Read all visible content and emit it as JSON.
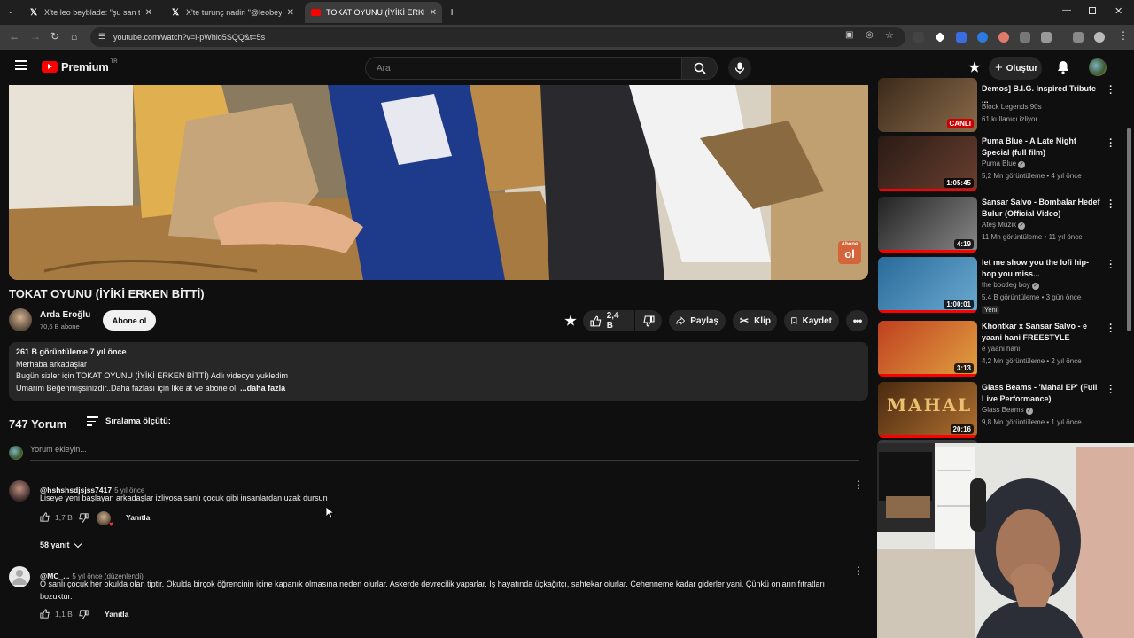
{
  "browser": {
    "tabs": [
      {
        "title": "X'te leo beyblade: \"şu san tişört",
        "favicon": "x-logo",
        "active": false
      },
      {
        "title": "X'te turunç nadiri \"@leobeyblade",
        "favicon": "x-logo",
        "active": false
      },
      {
        "title": "TOKAT OYUNU (İYİKİ ERKEN BİTTİ)",
        "favicon": "youtube-logo",
        "active": true
      }
    ],
    "url": "youtube.com/watch?v=i-pWhlo5SQQ&t=5s"
  },
  "header": {
    "brand": "Premium",
    "region": "TR",
    "search_placeholder": "Ara",
    "create_label": "Oluştur"
  },
  "video": {
    "title": "TOKAT OYUNU (İYİKİ ERKEN BİTTİ)",
    "watermark_line1": "Abone",
    "watermark_line2": "ol",
    "channel_name": "Arda Eroğlu",
    "subscribers": "70,6 B abone",
    "subscribe_label": "Abone ol",
    "like_count": "2,4 B",
    "share_label": "Paylaş",
    "clip_label": "Klip",
    "save_label": "Kaydet"
  },
  "description": {
    "stats": "261 B görüntüleme  7 yıl önce",
    "line1": "Merhaba arkadaşlar",
    "line2": "Bugün sizler için TOKAT OYUNU (İYİKİ ERKEN BİTTİ)  Adlı videoyu yukledim",
    "line3": "Umarım Beğenmişsinizdir..Daha fazlası için like at ve abone ol",
    "more": "...daha fazla"
  },
  "comments_section": {
    "count_label": "747 Yorum",
    "sort_label": "Sıralama ölçütü:",
    "add_placeholder": "Yorum ekleyin...",
    "comments": [
      {
        "author": "@hshshsdjsjss7417",
        "time": "5 yıl önce",
        "text": "Liseye yeni başlayan arkadaşlar izliyosa sanlı çocuk gibi insanlardan uzak dursun",
        "likes": "1,7 B",
        "reply_label": "Yanıtla",
        "replies_label": "58 yanıt"
      },
      {
        "author": "@MC_...",
        "time": "5 yıl önce (düzenlendi)",
        "text": "O sanlı çocuk her okulda olan tiptir. Okulda birçok öğrencinin içine kapanık olmasına neden olurlar. Askerde devrecilik yaparlar. İş hayatında üçkağıtçı, sahtekar olurlar. Cehenneme kadar giderler yani. Çünkü onların fıtratları",
        "text2": "bozuktur.",
        "likes": "1,1 B",
        "reply_label": "Yanıtla"
      }
    ]
  },
  "sidebar": {
    "items": [
      {
        "title": "Demos] B.I.G. Inspired Tribute ...",
        "channel": "Block Legends 90s",
        "meta": "61 kullanıcı izliyor",
        "badge": "CANLI",
        "duration": "",
        "colors": [
          "#3a2a1a",
          "#8a6a4a"
        ]
      },
      {
        "title": "Puma Blue - A Late Night Special (full film)",
        "channel": "Puma Blue",
        "verified": true,
        "meta": "5,2 Mn görüntüleme • 4 yıl önce",
        "duration": "1:05:45",
        "colors": [
          "#2a1a14",
          "#6a4030"
        ]
      },
      {
        "title": "Sansar Salvo - Bombalar Hedef Bulur (Official Video)",
        "channel": "Ateş Müzik",
        "verified": true,
        "meta": "11 Mn görüntüleme • 11 yıl önce",
        "duration": "4:19",
        "colors": [
          "#222",
          "#888"
        ]
      },
      {
        "title": "let me show you the lofi hip-hop you miss...",
        "channel": "the bootleg boy",
        "verified": true,
        "meta": "5,4 B görüntüleme • 3 gün önce",
        "new_badge": "Yeni",
        "duration": "1:00:01",
        "colors": [
          "#2a6a9a",
          "#6aaad0"
        ]
      },
      {
        "title": "Khontkar x Sansar Salvo - e yaani hani FREESTYLE",
        "channel": "e yaani hani",
        "meta": "4,2 Mn görüntüleme • 2 yıl önce",
        "duration": "3:13",
        "colors": [
          "#c04020",
          "#e0a040"
        ]
      },
      {
        "title": "Glass Beams - 'Mahal EP' (Full Live Performance)",
        "channel": "Glass Beams",
        "verified": true,
        "meta": "9,8 Mn görüntüleme • 1 yıl önce",
        "duration": "20:16",
        "thumb_text": "MAHAL",
        "colors": [
          "#4a2a10",
          "#b07030"
        ]
      }
    ]
  }
}
